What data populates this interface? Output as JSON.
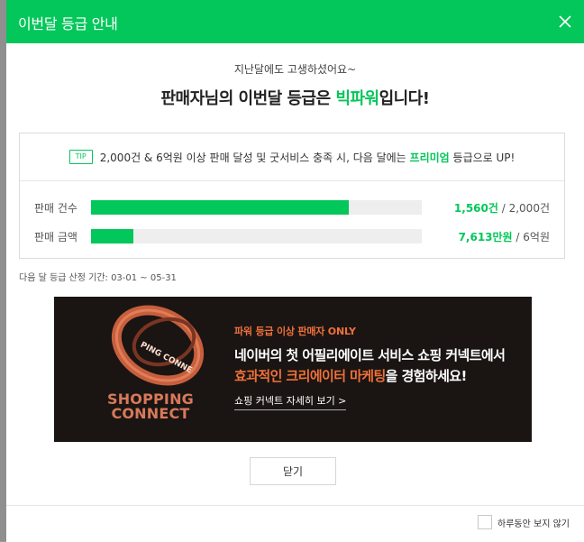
{
  "modal": {
    "title": "이번달 등급 안내",
    "sub_message": "지난달에도 고생하셨어요~",
    "headline_prefix": "판매자님의 이번달 등급은 ",
    "headline_grade": "빅파워",
    "headline_suffix": "입니다!",
    "tip": {
      "badge": "TIP",
      "text_before": "2,000건 & 6억원 이상 판매 달성 및 굿서비스 충족 시, 다음 달에는 ",
      "highlight": "프리미엄",
      "text_after": " 등급으로 UP!"
    },
    "metrics": [
      {
        "label": "판매 건수",
        "current": "1,560건",
        "target": " / 2,000건",
        "progress": 0.78
      },
      {
        "label": "판매 금액",
        "current": "7,613만원",
        "target": " / 6억원",
        "progress": 0.127
      }
    ],
    "period": "다음 달 등급 산정 기간: 03-01 ~ 05-31",
    "banner": {
      "ring_text": "PING CONNE",
      "brand_line1": "SHOPPING",
      "brand_line2": "CONNECT",
      "tag": "파워 등급 이상 판매자 ONLY",
      "line1": "네이버의 첫 어필리에이트 서비스 쇼핑 커넥트에서",
      "line2_accent": "효과적인 크리에이터 마케팅",
      "line2_rest": "을 경험하세요!",
      "link": "쇼핑 커넥트 자세히 보기 >"
    },
    "close_button": "닫기",
    "hide_today": "하루동안 보지 않기"
  },
  "colors": {
    "brand_green": "#03c75a",
    "banner_bg": "#1a1513",
    "banner_accent": "#f0703a",
    "track": "#eeeeee"
  },
  "icons": {
    "close": "close-icon",
    "ring": "shopping-connect-ring-logo"
  }
}
